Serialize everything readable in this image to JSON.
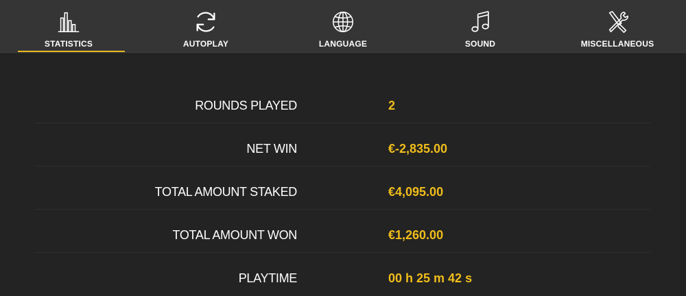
{
  "tabs": [
    {
      "id": "statistics",
      "label": "STATISTICS",
      "icon": "bar-chart-icon",
      "active": true
    },
    {
      "id": "autoplay",
      "label": "AUTOPLAY",
      "icon": "refresh-icon",
      "active": false
    },
    {
      "id": "language",
      "label": "LANGUAGE",
      "icon": "globe-icon",
      "active": false
    },
    {
      "id": "sound",
      "label": "SOUND",
      "icon": "music-note-icon",
      "active": false
    },
    {
      "id": "miscellaneous",
      "label": "MISCELLANEOUS",
      "icon": "tools-icon",
      "active": false
    }
  ],
  "stats": [
    {
      "label": "ROUNDS PLAYED",
      "value": "2"
    },
    {
      "label": "NET WIN",
      "value": "€-2,835.00"
    },
    {
      "label": "TOTAL AMOUNT STAKED",
      "value": "€4,095.00"
    },
    {
      "label": "TOTAL AMOUNT WON",
      "value": "€1,260.00"
    },
    {
      "label": "PLAYTIME",
      "value": "00 h 25 m 42 s"
    }
  ],
  "colors": {
    "accent": "#f0bd1b",
    "background": "#232323",
    "topbar": "#353535"
  }
}
